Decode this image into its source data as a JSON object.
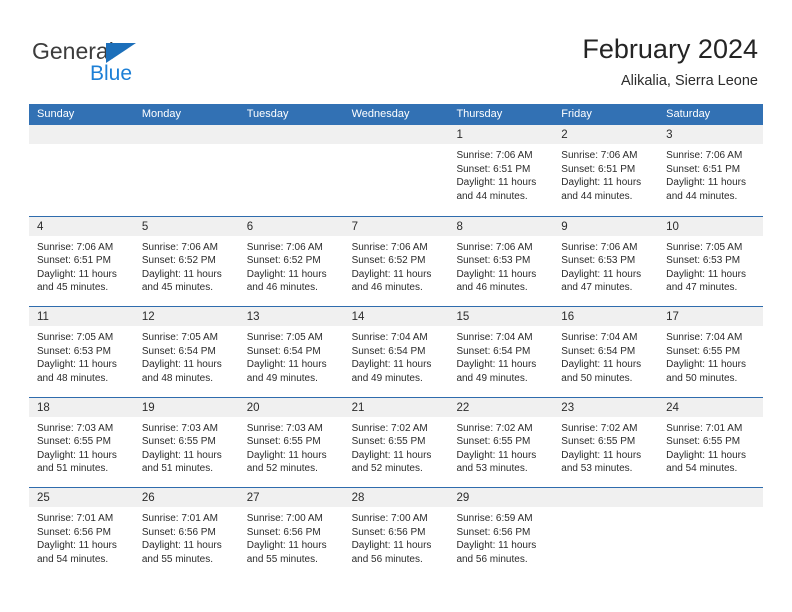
{
  "brand": {
    "name_top": "General",
    "name_bottom": "Blue",
    "logo_icon": "blue-triangle-logo",
    "accent_color": "#1c7fd6"
  },
  "header": {
    "title": "February 2024",
    "subtitle": "Alikalia, Sierra Leone"
  },
  "theme": {
    "header_bar_color": "#3271b4",
    "row_divider_color": "#2f6cad",
    "date_strip_color": "#f0f0f0"
  },
  "weekdays": [
    "Sunday",
    "Monday",
    "Tuesday",
    "Wednesday",
    "Thursday",
    "Friday",
    "Saturday"
  ],
  "weeks": [
    [
      {
        "day": "",
        "lines": []
      },
      {
        "day": "",
        "lines": []
      },
      {
        "day": "",
        "lines": []
      },
      {
        "day": "",
        "lines": []
      },
      {
        "day": "1",
        "lines": [
          "Sunrise: 7:06 AM",
          "Sunset: 6:51 PM",
          "Daylight: 11 hours",
          "and 44 minutes."
        ]
      },
      {
        "day": "2",
        "lines": [
          "Sunrise: 7:06 AM",
          "Sunset: 6:51 PM",
          "Daylight: 11 hours",
          "and 44 minutes."
        ]
      },
      {
        "day": "3",
        "lines": [
          "Sunrise: 7:06 AM",
          "Sunset: 6:51 PM",
          "Daylight: 11 hours",
          "and 44 minutes."
        ]
      }
    ],
    [
      {
        "day": "4",
        "lines": [
          "Sunrise: 7:06 AM",
          "Sunset: 6:51 PM",
          "Daylight: 11 hours",
          "and 45 minutes."
        ]
      },
      {
        "day": "5",
        "lines": [
          "Sunrise: 7:06 AM",
          "Sunset: 6:52 PM",
          "Daylight: 11 hours",
          "and 45 minutes."
        ]
      },
      {
        "day": "6",
        "lines": [
          "Sunrise: 7:06 AM",
          "Sunset: 6:52 PM",
          "Daylight: 11 hours",
          "and 46 minutes."
        ]
      },
      {
        "day": "7",
        "lines": [
          "Sunrise: 7:06 AM",
          "Sunset: 6:52 PM",
          "Daylight: 11 hours",
          "and 46 minutes."
        ]
      },
      {
        "day": "8",
        "lines": [
          "Sunrise: 7:06 AM",
          "Sunset: 6:53 PM",
          "Daylight: 11 hours",
          "and 46 minutes."
        ]
      },
      {
        "day": "9",
        "lines": [
          "Sunrise: 7:06 AM",
          "Sunset: 6:53 PM",
          "Daylight: 11 hours",
          "and 47 minutes."
        ]
      },
      {
        "day": "10",
        "lines": [
          "Sunrise: 7:05 AM",
          "Sunset: 6:53 PM",
          "Daylight: 11 hours",
          "and 47 minutes."
        ]
      }
    ],
    [
      {
        "day": "11",
        "lines": [
          "Sunrise: 7:05 AM",
          "Sunset: 6:53 PM",
          "Daylight: 11 hours",
          "and 48 minutes."
        ]
      },
      {
        "day": "12",
        "lines": [
          "Sunrise: 7:05 AM",
          "Sunset: 6:54 PM",
          "Daylight: 11 hours",
          "and 48 minutes."
        ]
      },
      {
        "day": "13",
        "lines": [
          "Sunrise: 7:05 AM",
          "Sunset: 6:54 PM",
          "Daylight: 11 hours",
          "and 49 minutes."
        ]
      },
      {
        "day": "14",
        "lines": [
          "Sunrise: 7:04 AM",
          "Sunset: 6:54 PM",
          "Daylight: 11 hours",
          "and 49 minutes."
        ]
      },
      {
        "day": "15",
        "lines": [
          "Sunrise: 7:04 AM",
          "Sunset: 6:54 PM",
          "Daylight: 11 hours",
          "and 49 minutes."
        ]
      },
      {
        "day": "16",
        "lines": [
          "Sunrise: 7:04 AM",
          "Sunset: 6:54 PM",
          "Daylight: 11 hours",
          "and 50 minutes."
        ]
      },
      {
        "day": "17",
        "lines": [
          "Sunrise: 7:04 AM",
          "Sunset: 6:55 PM",
          "Daylight: 11 hours",
          "and 50 minutes."
        ]
      }
    ],
    [
      {
        "day": "18",
        "lines": [
          "Sunrise: 7:03 AM",
          "Sunset: 6:55 PM",
          "Daylight: 11 hours",
          "and 51 minutes."
        ]
      },
      {
        "day": "19",
        "lines": [
          "Sunrise: 7:03 AM",
          "Sunset: 6:55 PM",
          "Daylight: 11 hours",
          "and 51 minutes."
        ]
      },
      {
        "day": "20",
        "lines": [
          "Sunrise: 7:03 AM",
          "Sunset: 6:55 PM",
          "Daylight: 11 hours",
          "and 52 minutes."
        ]
      },
      {
        "day": "21",
        "lines": [
          "Sunrise: 7:02 AM",
          "Sunset: 6:55 PM",
          "Daylight: 11 hours",
          "and 52 minutes."
        ]
      },
      {
        "day": "22",
        "lines": [
          "Sunrise: 7:02 AM",
          "Sunset: 6:55 PM",
          "Daylight: 11 hours",
          "and 53 minutes."
        ]
      },
      {
        "day": "23",
        "lines": [
          "Sunrise: 7:02 AM",
          "Sunset: 6:55 PM",
          "Daylight: 11 hours",
          "and 53 minutes."
        ]
      },
      {
        "day": "24",
        "lines": [
          "Sunrise: 7:01 AM",
          "Sunset: 6:55 PM",
          "Daylight: 11 hours",
          "and 54 minutes."
        ]
      }
    ],
    [
      {
        "day": "25",
        "lines": [
          "Sunrise: 7:01 AM",
          "Sunset: 6:56 PM",
          "Daylight: 11 hours",
          "and 54 minutes."
        ]
      },
      {
        "day": "26",
        "lines": [
          "Sunrise: 7:01 AM",
          "Sunset: 6:56 PM",
          "Daylight: 11 hours",
          "and 55 minutes."
        ]
      },
      {
        "day": "27",
        "lines": [
          "Sunrise: 7:00 AM",
          "Sunset: 6:56 PM",
          "Daylight: 11 hours",
          "and 55 minutes."
        ]
      },
      {
        "day": "28",
        "lines": [
          "Sunrise: 7:00 AM",
          "Sunset: 6:56 PM",
          "Daylight: 11 hours",
          "and 56 minutes."
        ]
      },
      {
        "day": "29",
        "lines": [
          "Sunrise: 6:59 AM",
          "Sunset: 6:56 PM",
          "Daylight: 11 hours",
          "and 56 minutes."
        ]
      },
      {
        "day": "",
        "lines": []
      },
      {
        "day": "",
        "lines": []
      }
    ]
  ]
}
